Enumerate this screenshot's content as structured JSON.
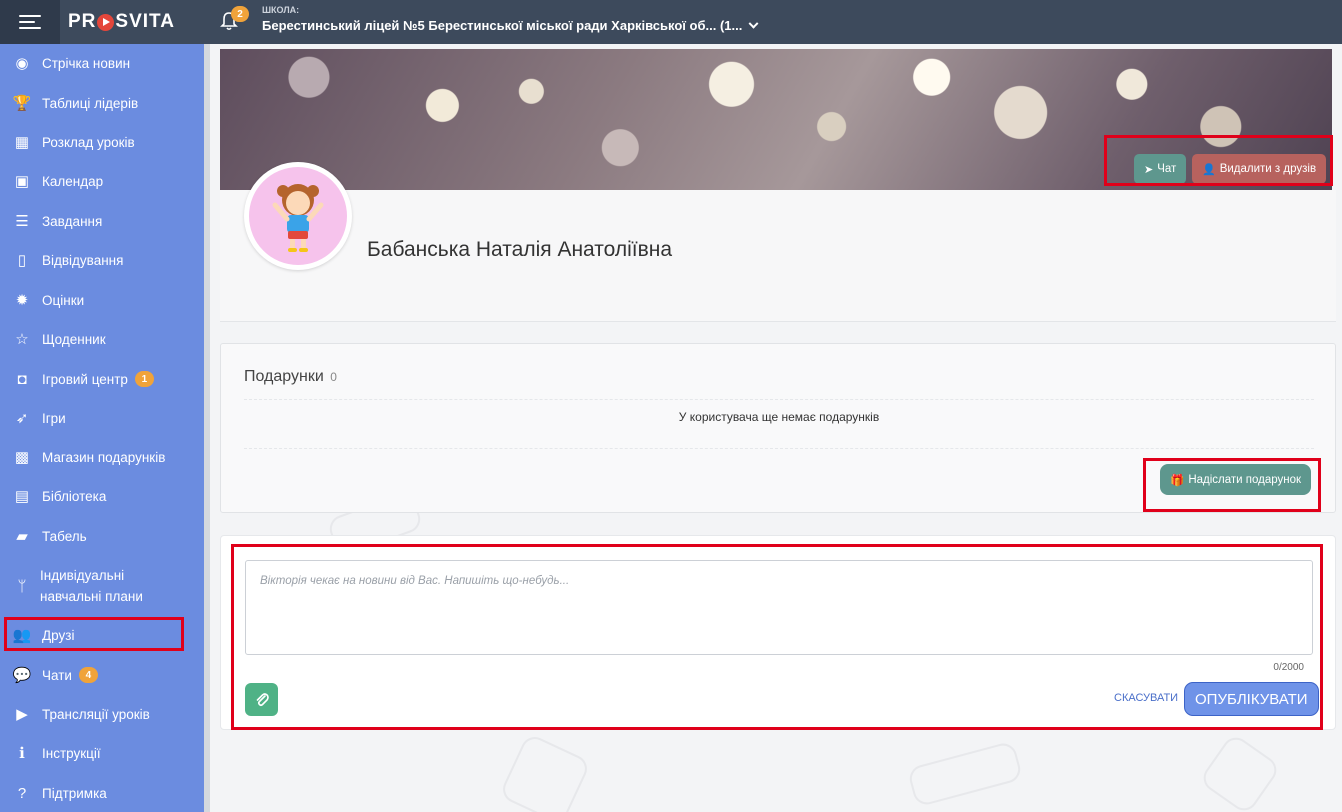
{
  "header": {
    "brand": "PROSVITA",
    "brand_parts": [
      "PR",
      "SVITA"
    ],
    "notifications_count": "2",
    "school_label": "ШКОЛА:",
    "school_name": "Берестинський ліцей №5 Берестинської міської ради Харківської об... (1..."
  },
  "sidebar": {
    "items": [
      {
        "label": "Стрічка новин",
        "icon": "rss-icon",
        "glyph": "◉"
      },
      {
        "label": "Таблиці лідерів",
        "icon": "trophy-icon",
        "glyph": "🏆"
      },
      {
        "label": "Розклад уроків",
        "icon": "table-calendar-icon",
        "glyph": "▦"
      },
      {
        "label": "Календар",
        "icon": "calendar-icon",
        "glyph": "▣"
      },
      {
        "label": "Завдання",
        "icon": "tasks-icon",
        "glyph": "☰"
      },
      {
        "label": "Відвідування",
        "icon": "document-icon",
        "glyph": "▯"
      },
      {
        "label": "Оцінки",
        "icon": "badge-icon",
        "glyph": "✹"
      },
      {
        "label": "Щоденник",
        "icon": "star-icon",
        "glyph": "☆"
      },
      {
        "label": "Ігровий центр",
        "icon": "gamepad-icon",
        "glyph": "◘",
        "badge": "1"
      },
      {
        "label": "Ігри",
        "icon": "rocket-icon",
        "glyph": "➶"
      },
      {
        "label": "Магазин подарунків",
        "icon": "gift-icon",
        "glyph": "▩"
      },
      {
        "label": "Бібліотека",
        "icon": "book-icon",
        "glyph": "▤"
      },
      {
        "label": "Табель",
        "icon": "folder-open-icon",
        "glyph": "▰"
      },
      {
        "label": "Індивідуальні навчальні плани",
        "icon": "branch-icon",
        "glyph": "ᛘ"
      },
      {
        "label": "Друзі",
        "icon": "users-icon",
        "glyph": "👥"
      },
      {
        "label": "Чати",
        "icon": "chat-bubbles-icon",
        "glyph": "💬",
        "badge": "4"
      },
      {
        "label": "Трансляції уроків",
        "icon": "video-icon",
        "glyph": "▶"
      },
      {
        "label": "Інструкції",
        "icon": "info-icon",
        "glyph": "ℹ"
      },
      {
        "label": "Підтримка",
        "icon": "question-icon",
        "glyph": "?"
      }
    ]
  },
  "profile": {
    "chat_label": "Чат",
    "unfriend_label": "Видалити з друзів",
    "name": "Бабанська Наталія Анатоліївна"
  },
  "gifts": {
    "title": "Подарунки",
    "count": "0",
    "empty_text": "У користувача ще немає подарунків",
    "send_label": "Надіслати подарунок"
  },
  "post": {
    "placeholder": "Вікторія чекає на новини від Вас. Напишіть що-небудь...",
    "counter": "0/2000",
    "cancel_label": "СКАСУВАТИ",
    "publish_label": "ОПУБЛІКУВАТИ"
  },
  "colors": {
    "sidebar_bg": "#6b8ce0",
    "topbar_bg": "#3d4a5c",
    "teal_button": "#5e978e",
    "red_button": "#b7625e",
    "green_button": "#4fb286",
    "publish_button": "#6f93e8",
    "badge": "#f0a33a",
    "highlight": "#e0001a"
  }
}
